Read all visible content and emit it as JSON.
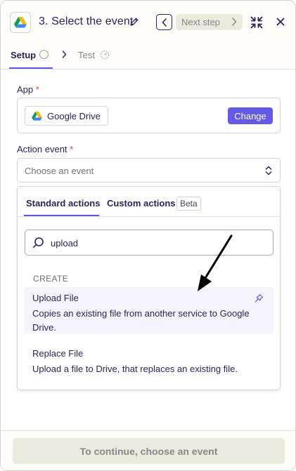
{
  "header": {
    "title": "3. Select the event",
    "next_step_label": "Next step"
  },
  "steps": {
    "setup_label": "Setup",
    "test_label": "Test"
  },
  "form": {
    "app_label": "App",
    "app_required": "*",
    "app_name": "Google Drive",
    "change_label": "Change",
    "action_event_label": "Action event",
    "action_required": "*",
    "action_placeholder": "Choose an event"
  },
  "dropdown": {
    "tab_standard": "Standard actions",
    "tab_custom": "Custom actions",
    "beta_badge": "Beta",
    "search_value": "upload",
    "section_label": "CREATE",
    "results": [
      {
        "title": "Upload File",
        "description": "Copies an existing file from another service to Google Drive.",
        "highlighted": true
      },
      {
        "title": "Replace File",
        "description": "Upload a file to Drive, that replaces an existing file.",
        "highlighted": false
      }
    ]
  },
  "footer": {
    "continue_label": "To continue, choose an event"
  },
  "colors": {
    "accent": "#5c55e8",
    "button_primary": "#6559e8",
    "required": "#e0462f",
    "text": "#2b2358",
    "muted": "#8a8789"
  },
  "icons": {
    "app": "google-drive-icon",
    "edit": "pencil-icon",
    "prev": "chevron-left-icon",
    "collapse": "collapse-icon",
    "close": "close-icon",
    "search": "search-icon",
    "pin": "pin-icon",
    "annotation": "arrow-annotation"
  }
}
